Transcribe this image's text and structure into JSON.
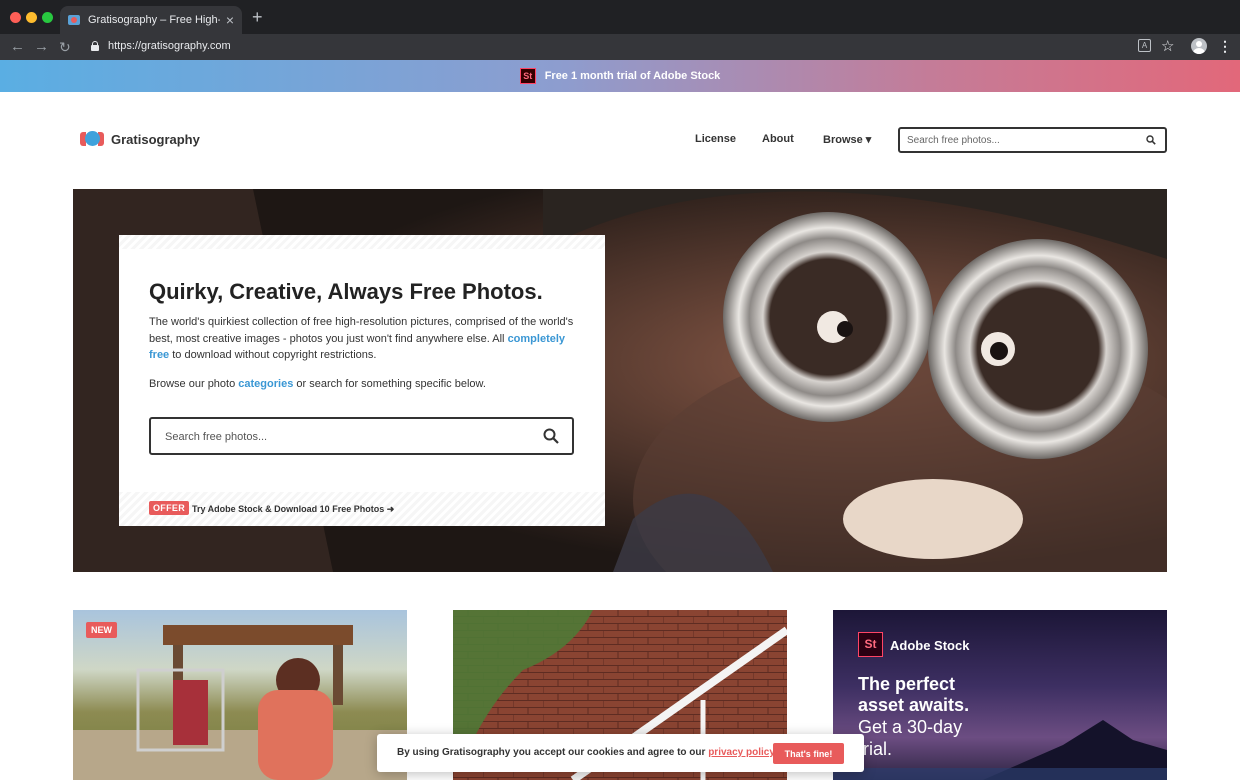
{
  "browser": {
    "tab_title": "Gratisography – Free High-Res",
    "url": "https://gratisography.com",
    "tab_close_glyph": "×",
    "new_tab_glyph": "+"
  },
  "promo": {
    "logo": "St",
    "text": "Free 1 month trial of Adobe Stock"
  },
  "header": {
    "brand": "Gratisography",
    "nav": {
      "license": "License",
      "about": "About",
      "browse": "Browse ▾"
    },
    "search_placeholder": "Search free photos..."
  },
  "hero": {
    "title": "Quirky, Creative, Always Free Photos.",
    "desc_before": "The world's quirkiest collection of free high-resolution pictures, comprised of the world's best, most creative images - photos you just won't find anywhere else. All ",
    "desc_link": "completely free",
    "desc_after": " to download without copyright restrictions.",
    "browse_before": "Browse our photo ",
    "browse_link": "categories",
    "browse_after": " or search for something specific below.",
    "search_placeholder": "Search free photos...",
    "offer_badge": "OFFER",
    "offer_text": "Try Adobe Stock & Download 10 Free Photos ➜"
  },
  "cards": {
    "new_badge": "NEW",
    "adobe": {
      "logo": "St",
      "name": "Adobe Stock",
      "headline_1": "The perfect",
      "headline_2": "asset awaits.",
      "sub_1": "Get a 30-day",
      "sub_2": "trial."
    }
  },
  "cookie": {
    "text_before": "By using Gratisography you accept our cookies and agree to our ",
    "link": "privacy policy.",
    "button": "That's fine!"
  },
  "colors": {
    "accent_red": "#e85b5b",
    "link_blue": "#3a97d4",
    "browser_dark": "#202124"
  }
}
